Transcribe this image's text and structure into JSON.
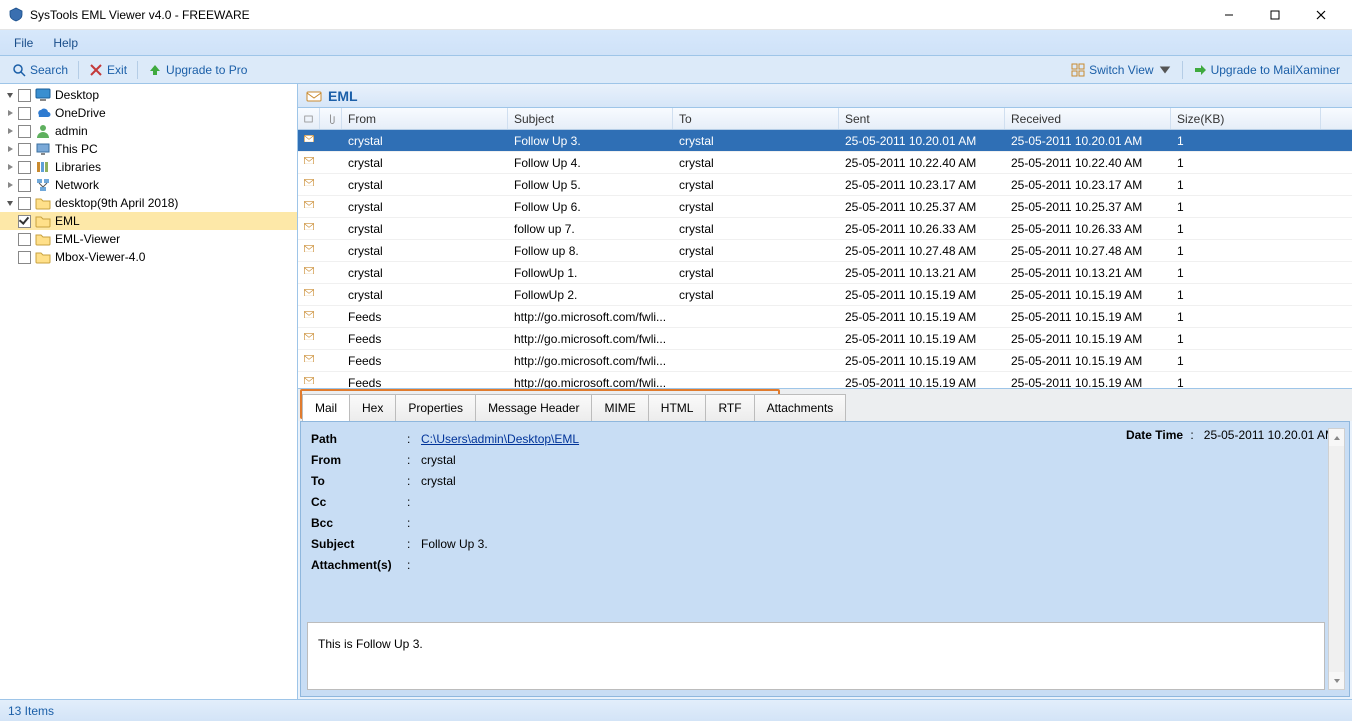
{
  "window": {
    "title": "SysTools EML Viewer v4.0 - FREEWARE"
  },
  "menu": {
    "file": "File",
    "help": "Help"
  },
  "toolbar": {
    "search": "Search",
    "exit": "Exit",
    "upgrade": "Upgrade to Pro",
    "switch_view": "Switch View",
    "upgrade_mx": "Upgrade to MailXaminer"
  },
  "tree": {
    "nodes": [
      {
        "indent": 0,
        "expand": "open",
        "check": false,
        "icon": "desktop",
        "label": "Desktop"
      },
      {
        "indent": 1,
        "expand": "closed",
        "check": false,
        "icon": "onedrive",
        "label": "OneDrive"
      },
      {
        "indent": 1,
        "expand": "closed",
        "check": false,
        "icon": "user",
        "label": "admin"
      },
      {
        "indent": 1,
        "expand": "closed",
        "check": false,
        "icon": "pc",
        "label": "This PC"
      },
      {
        "indent": 1,
        "expand": "closed",
        "check": false,
        "icon": "libraries",
        "label": "Libraries"
      },
      {
        "indent": 1,
        "expand": "closed",
        "check": false,
        "icon": "network",
        "label": "Network"
      },
      {
        "indent": 1,
        "expand": "open",
        "check": false,
        "icon": "folder",
        "label": "desktop(9th April 2018)"
      },
      {
        "indent": 2,
        "expand": "none",
        "check": true,
        "icon": "folder",
        "label": "EML",
        "selected": true
      },
      {
        "indent": 2,
        "expand": "none",
        "check": false,
        "icon": "folder",
        "label": "EML-Viewer"
      },
      {
        "indent": 2,
        "expand": "none",
        "check": false,
        "icon": "folder",
        "label": "Mbox-Viewer-4.0"
      }
    ]
  },
  "panel": {
    "title": "EML"
  },
  "grid": {
    "headers": {
      "from": "From",
      "subject": "Subject",
      "to": "To",
      "sent": "Sent",
      "received": "Received",
      "size": "Size(KB)"
    },
    "rows": [
      {
        "from": "crystal",
        "subject": "Follow Up 3.",
        "to": "crystal",
        "sent": "25-05-2011 10.20.01 AM",
        "recv": "25-05-2011 10.20.01 AM",
        "size": "1",
        "selected": true
      },
      {
        "from": "crystal",
        "subject": "Follow Up 4.",
        "to": "crystal",
        "sent": "25-05-2011 10.22.40 AM",
        "recv": "25-05-2011 10.22.40 AM",
        "size": "1"
      },
      {
        "from": "crystal",
        "subject": "Follow Up 5.",
        "to": "crystal",
        "sent": "25-05-2011 10.23.17 AM",
        "recv": "25-05-2011 10.23.17 AM",
        "size": "1"
      },
      {
        "from": "crystal",
        "subject": "Follow Up 6.",
        "to": "crystal",
        "sent": "25-05-2011 10.25.37 AM",
        "recv": "25-05-2011 10.25.37 AM",
        "size": "1"
      },
      {
        "from": "crystal",
        "subject": "follow up 7.",
        "to": "crystal",
        "sent": "25-05-2011 10.26.33 AM",
        "recv": "25-05-2011 10.26.33 AM",
        "size": "1"
      },
      {
        "from": "crystal",
        "subject": "Follow up 8.",
        "to": "crystal",
        "sent": "25-05-2011 10.27.48 AM",
        "recv": "25-05-2011 10.27.48 AM",
        "size": "1"
      },
      {
        "from": "crystal",
        "subject": "FollowUp 1.",
        "to": "crystal",
        "sent": "25-05-2011 10.13.21 AM",
        "recv": "25-05-2011 10.13.21 AM",
        "size": "1"
      },
      {
        "from": "crystal",
        "subject": "FollowUp 2.",
        "to": "crystal",
        "sent": "25-05-2011 10.15.19 AM",
        "recv": "25-05-2011 10.15.19 AM",
        "size": "1"
      },
      {
        "from": "Feeds",
        "subject": "http://go.microsoft.com/fwli...",
        "to": "",
        "sent": "25-05-2011 10.15.19 AM",
        "recv": "25-05-2011 10.15.19 AM",
        "size": "1"
      },
      {
        "from": "Feeds",
        "subject": "http://go.microsoft.com/fwli...",
        "to": "",
        "sent": "25-05-2011 10.15.19 AM",
        "recv": "25-05-2011 10.15.19 AM",
        "size": "1"
      },
      {
        "from": "Feeds",
        "subject": "http://go.microsoft.com/fwli...",
        "to": "",
        "sent": "25-05-2011 10.15.19 AM",
        "recv": "25-05-2011 10.15.19 AM",
        "size": "1"
      },
      {
        "from": "Feeds",
        "subject": "http://go.microsoft.com/fwli...",
        "to": "",
        "sent": "25-05-2011 10.15.19 AM",
        "recv": "25-05-2011 10.15.19 AM",
        "size": "1"
      }
    ]
  },
  "tabs": {
    "items": [
      "Mail",
      "Hex",
      "Properties",
      "Message Header",
      "MIME",
      "HTML",
      "RTF",
      "Attachments"
    ],
    "active": 0,
    "highlight_width": 480
  },
  "detail": {
    "path_label": "Path",
    "path": "C:\\Users\\admin\\Desktop\\EML",
    "from_label": "From",
    "from": "crystal",
    "to_label": "To",
    "to": "crystal",
    "cc_label": "Cc",
    "cc": "",
    "bcc_label": "Bcc",
    "bcc": "",
    "subject_label": "Subject",
    "subject": "Follow Up 3.",
    "att_label": "Attachment(s)",
    "att": "",
    "datetime_label": "Date Time",
    "datetime": "25-05-2011 10.20.01 AM",
    "body": "This is Follow Up 3."
  },
  "status": {
    "text": "13 Items"
  }
}
